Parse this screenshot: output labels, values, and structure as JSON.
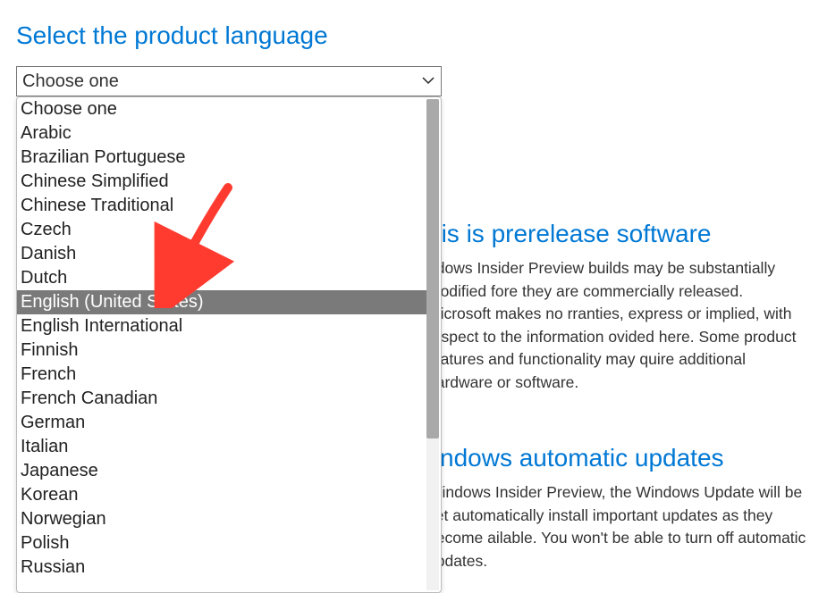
{
  "heading": "Select the product language",
  "select": {
    "displayed": "Choose one",
    "highlighted_index": 8,
    "options": [
      "Choose one",
      "Arabic",
      "Brazilian Portuguese",
      "Chinese Simplified",
      "Chinese Traditional",
      "Czech",
      "Danish",
      "Dutch",
      "English (United States)",
      "English International",
      "Finnish",
      "French",
      "French Canadian",
      "German",
      "Italian",
      "Japanese",
      "Korean",
      "Norwegian",
      "Polish",
      "Russian"
    ]
  },
  "section1": {
    "heading_fragment": "his is prerelease software",
    "body_fragment": "ndows Insider Preview builds may be substantially modified fore they are commercially released. Microsoft makes no rranties, express or implied, with respect to the information ovided here. Some product features and functionality may quire additional hardware or software."
  },
  "section2": {
    "heading_fragment": "/indows automatic updates",
    "body_fragment": "Windows Insider Preview, the Windows Update will be set automatically install important updates as they become ailable. You won't be able to turn off automatic updates."
  },
  "annotation": {
    "arrow_color": "#ff3b30"
  }
}
